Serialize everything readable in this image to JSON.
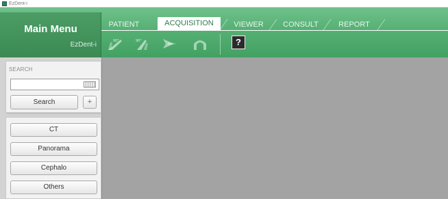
{
  "window": {
    "title": "EzDent-i"
  },
  "main_menu": {
    "title": "Main Menu",
    "subtitle": "EzDent-i"
  },
  "tabs": [
    {
      "label": "PATIENT",
      "active": false
    },
    {
      "label": "ACQUISITION",
      "active": true
    },
    {
      "label": "VIEWER",
      "active": false
    },
    {
      "label": "CONSULT",
      "active": false
    },
    {
      "label": "REPORT",
      "active": false
    }
  ],
  "toolbar": {
    "tools": [
      {
        "icon": "xray-capture-90-left-icon"
      },
      {
        "icon": "xray-capture-90-right-icon"
      },
      {
        "icon": "xray-transfer-icon"
      },
      {
        "icon": "xray-arch-icon"
      }
    ],
    "help_label": "?"
  },
  "search": {
    "label": "SEARCH",
    "input_value": "",
    "button_label": "Search",
    "add_label": "+"
  },
  "modalities": [
    {
      "label": "CT"
    },
    {
      "label": "Panorama"
    },
    {
      "label": "Cephalo"
    },
    {
      "label": "Others"
    }
  ],
  "colors": {
    "header_green": "#56b074",
    "active_tab_text": "#2e7a49",
    "content_gray": "#a3a3a3"
  }
}
